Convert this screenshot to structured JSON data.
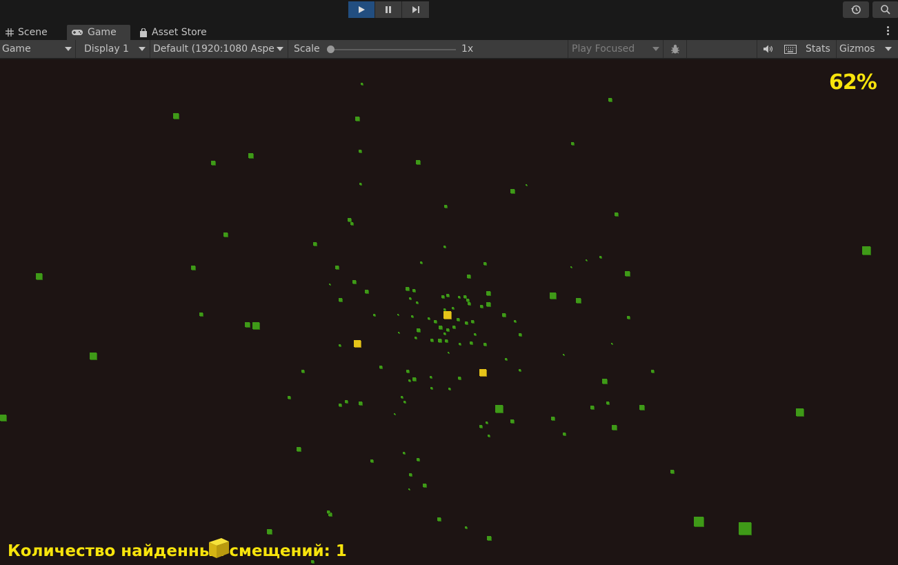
{
  "tabs": [
    {
      "label": "Scene",
      "icon": "grid-icon"
    },
    {
      "label": "Game",
      "icon": "gamepad-icon"
    },
    {
      "label": "Asset Store",
      "icon": "shopping-bag-icon"
    }
  ],
  "toolbar": {
    "view_dropdown": "Game",
    "display_dropdown": "Display 1",
    "aspect_dropdown": "Default (1920:1080 Aspe",
    "scale_label": "Scale",
    "scale_value": "1x",
    "play_mode_dropdown": "Play Focused",
    "stats_label": "Stats",
    "gizmos_label": "Gizmos"
  },
  "game": {
    "progress_text": "62%",
    "counter_text": "Количество найденных смещений: 1"
  },
  "colors": {
    "accent_play": "#224e80",
    "hud_text": "#f7e40c",
    "cube_green": "#3f9a18",
    "cube_gold": "#e6c419",
    "viewport_bg": "#1d1413"
  }
}
